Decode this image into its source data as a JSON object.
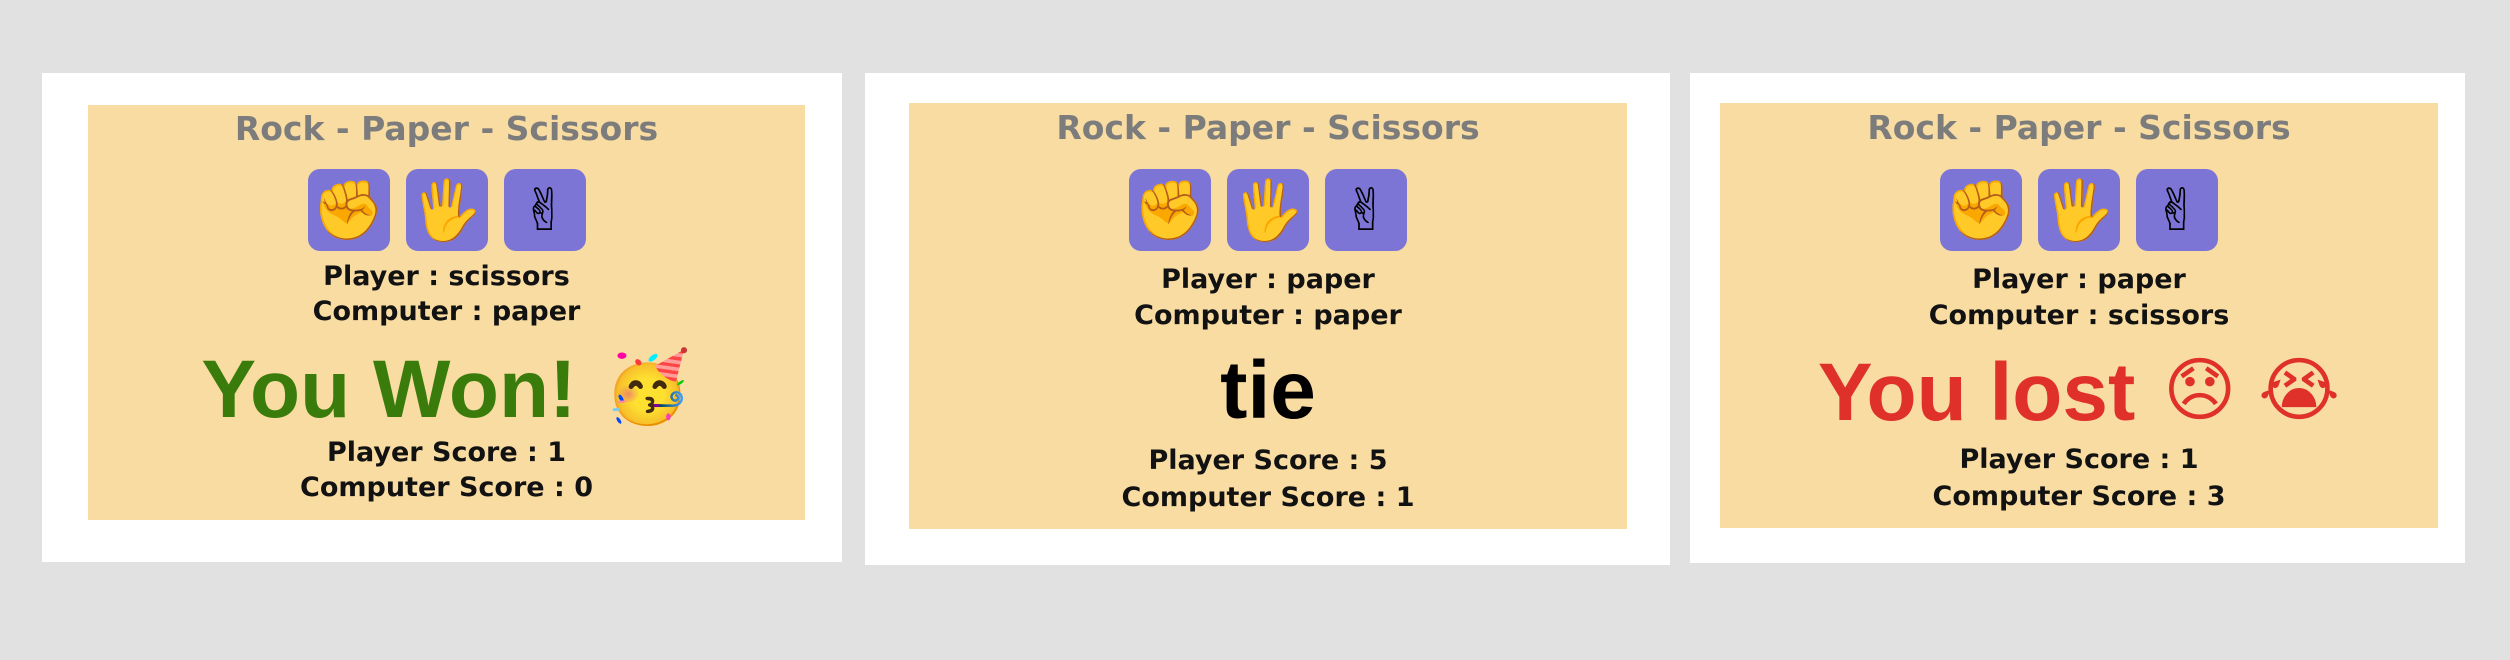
{
  "colors": {
    "background": "#e1e1e1",
    "panel": "#ffffff",
    "card": "#f8dca2",
    "title": "#7c7c7c",
    "button": "#7d75d5",
    "win": "#3a7c0b",
    "tie": "#000000",
    "lose": "#e0302a"
  },
  "games": [
    {
      "title": "Rock - Paper - Scissors",
      "choices": [
        {
          "icon": "✊",
          "name": "rock"
        },
        {
          "icon": "🖐",
          "name": "paper"
        },
        {
          "icon": "✌",
          "name": "scissors"
        }
      ],
      "player_choice": "Player : scissors",
      "computer_choice": "Computer : paper",
      "result": "You Won!",
      "result_emojis": [
        "🥳"
      ],
      "player_score": "Player Score : 1",
      "computer_score": "Computer Score : 0"
    },
    {
      "title": "Rock - Paper - Scissors",
      "choices": [
        {
          "icon": "✊",
          "name": "rock"
        },
        {
          "icon": "🖐",
          "name": "paper"
        },
        {
          "icon": "✌",
          "name": "scissors"
        }
      ],
      "player_choice": "Player : paper",
      "computer_choice": "Computer : paper",
      "result": "tie",
      "result_emojis": [],
      "player_score": "Player Score : 5",
      "computer_score": "Computer Score : 1"
    },
    {
      "title": "Rock - Paper - Scissors",
      "choices": [
        {
          "icon": "✊",
          "name": "rock"
        },
        {
          "icon": "🖐",
          "name": "paper"
        },
        {
          "icon": "✌",
          "name": "scissors"
        }
      ],
      "player_choice": "Player : paper",
      "computer_choice": "Computer : scissors",
      "result": "You lost",
      "result_emojis": [
        "😞",
        "😭"
      ],
      "player_score": "Player Score : 1",
      "computer_score": "Computer Score : 3"
    }
  ]
}
